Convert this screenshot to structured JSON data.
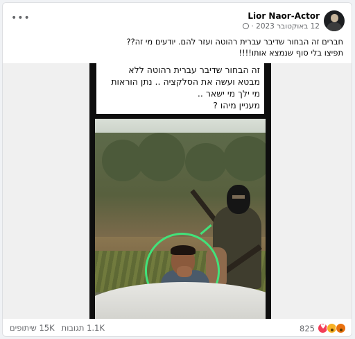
{
  "post": {
    "author": "Lior Naor-Actor",
    "timestamp": "12 באוקטובר 2023",
    "text_lines": [
      "חברים זה הבחור שדיבר עברית רהוטה ועזר להם. יודעים מי זה??",
      "תפיצו בלי סוף שנמצא אותו!!!!"
    ],
    "options_icon": "more-horizontal-icon"
  },
  "media": {
    "caption_lines": [
      "זה הבחור שדיבר עברית רהוטה ללא",
      "מבטא ועשה את הסלקציה .. נתן הוראות",
      "מי ילך מי ישאר ..",
      "מעניין מיהו ?"
    ],
    "highlight_color": "#42e27a"
  },
  "footer": {
    "reactions_count": "825",
    "reaction_icons": [
      "love-icon",
      "wow-icon",
      "angry-icon"
    ],
    "comments": "1.1K תגובות",
    "shares": "15K שיתופים"
  }
}
